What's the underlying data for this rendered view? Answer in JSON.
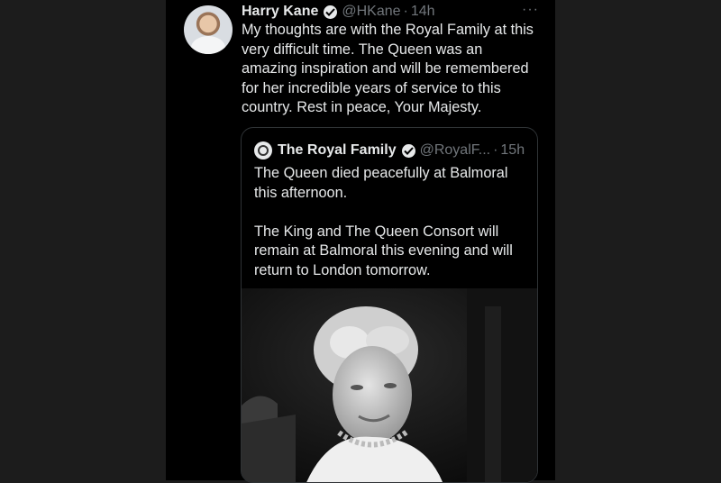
{
  "tweet": {
    "author_name": "Harry Kane",
    "handle": "@HKane",
    "separator": "·",
    "time": "14h",
    "more_icon": "···",
    "text": "My thoughts are with the Royal Family at this very difficult time. The Queen was an amazing inspiration and will be remembered for her incredible years of service to this country. Rest in peace, Your Majesty."
  },
  "quote": {
    "author_name": "The Royal Family",
    "handle": "@RoyalF...",
    "separator": "·",
    "time": "15h",
    "paragraphs": [
      "The Queen died peacefully at Balmoral this afternoon.",
      "The King and The Queen Consort will remain at Balmoral this evening and will return to London tomorrow."
    ]
  },
  "icons": {
    "verified": "verified-badge-icon",
    "more": "more-options-icon"
  },
  "colors": {
    "background": "#000000",
    "text": "#e7e9ea",
    "muted": "#71767b",
    "border": "#2f3336"
  }
}
